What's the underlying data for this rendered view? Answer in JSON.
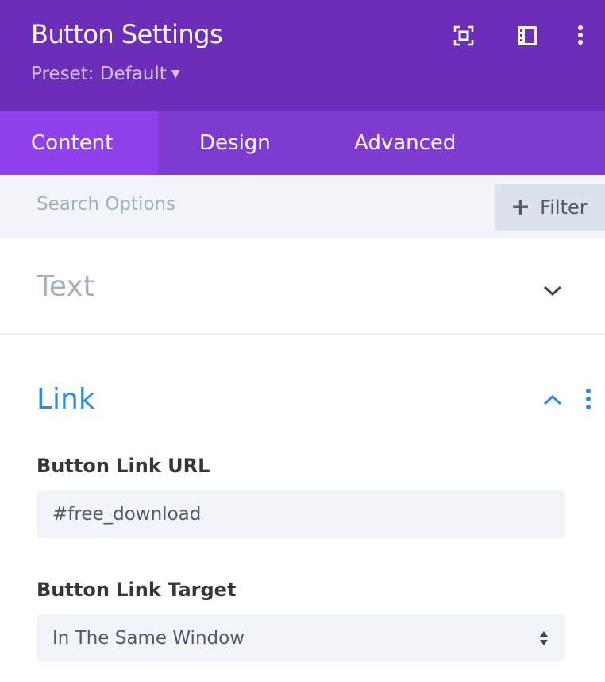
{
  "header": {
    "title": "Button Settings",
    "preset": "Preset: Default"
  },
  "tabs": [
    {
      "label": "Content",
      "active": true
    },
    {
      "label": "Design"
    },
    {
      "label": "Advanced"
    }
  ],
  "search": {
    "placeholder": "Search Options",
    "filter_label": "Filter"
  },
  "sections": {
    "text": {
      "label": "Text",
      "expanded": false
    },
    "link": {
      "label": "Link",
      "expanded": true
    }
  },
  "fields": {
    "url": {
      "label": "Button Link URL",
      "value": "#free_download"
    },
    "target": {
      "label": "Button Link Target",
      "value": "In The Same Window"
    }
  },
  "colors": {
    "header": "#6c2eb9",
    "tabs": "#7d3bcf",
    "active_tab": "#8f42ec",
    "accent": "#2e8ce0"
  }
}
